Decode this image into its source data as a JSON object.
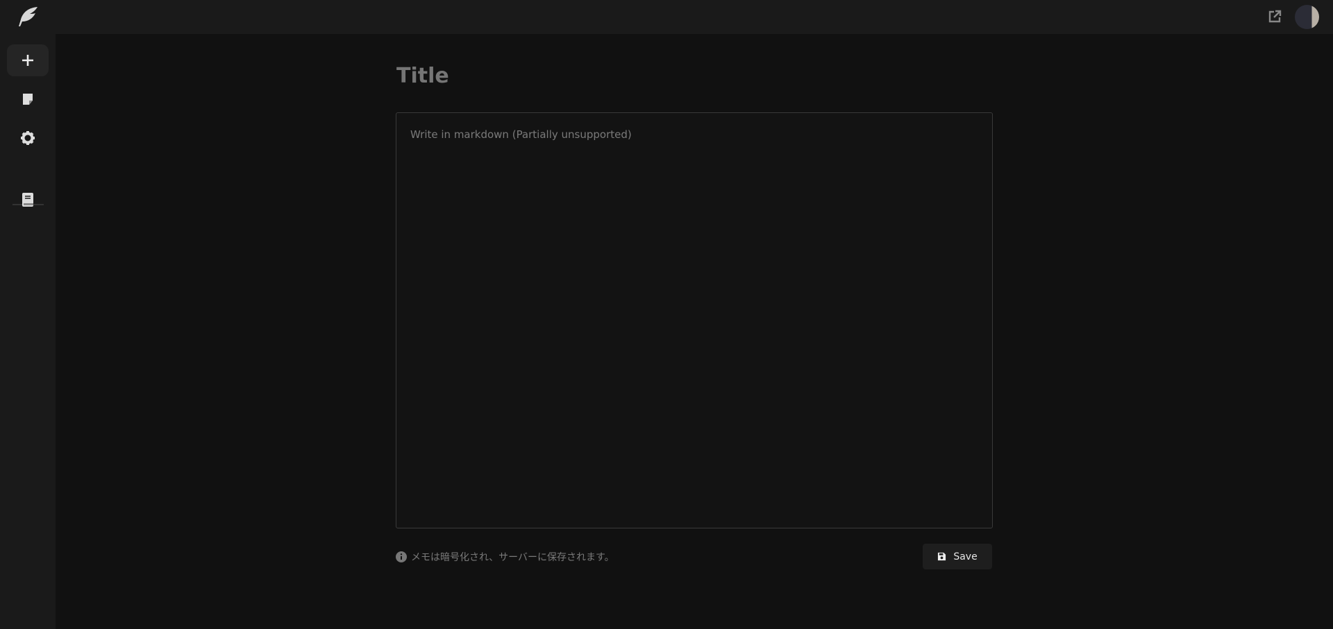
{
  "header": {
    "external_link_icon": "external-link-icon",
    "avatar": "user-avatar"
  },
  "sidebar": {
    "items": [
      {
        "icon": "plus-icon",
        "active": true
      },
      {
        "icon": "note-icon"
      },
      {
        "icon": "gear-icon"
      },
      {
        "icon": "book-icon"
      }
    ]
  },
  "editor": {
    "title_placeholder": "Title",
    "body_placeholder": "Write in markdown (Partially unsupported)"
  },
  "footer": {
    "note": "メモは暗号化され、サーバーに保存されます。",
    "save_label": "Save"
  }
}
